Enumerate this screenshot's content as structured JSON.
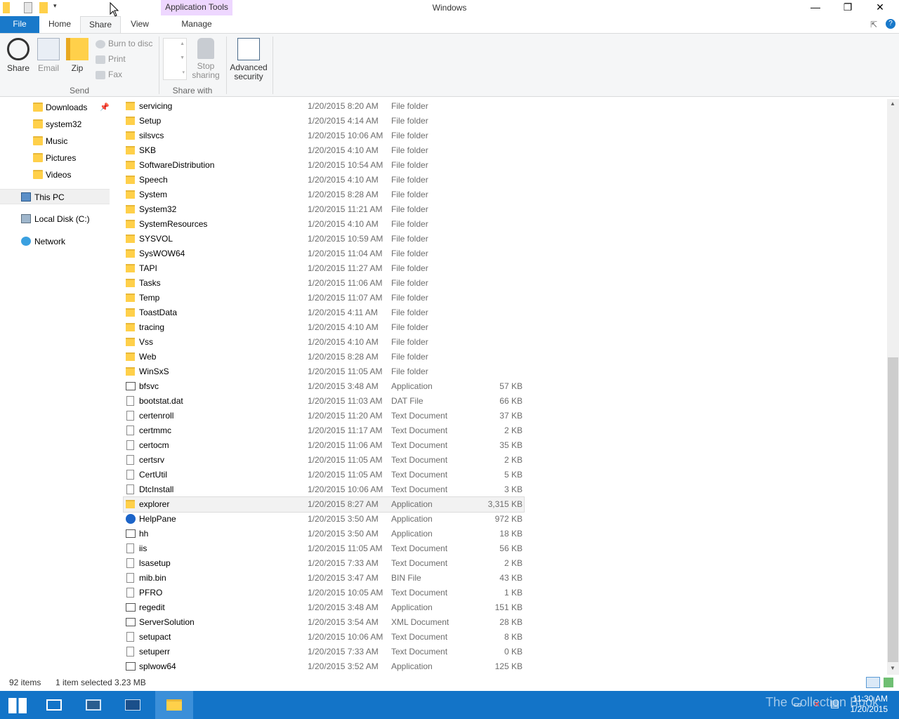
{
  "window": {
    "title": "Windows",
    "context_tab": "Application Tools",
    "controls": {
      "minimize": "—",
      "restore": "❐",
      "close": "✕"
    }
  },
  "ribbon_tabs": [
    "File",
    "Home",
    "Share",
    "View",
    "Manage"
  ],
  "ribbon": {
    "send": {
      "share": "Share",
      "email": "Email",
      "zip": "Zip",
      "burn": "Burn to disc",
      "print": "Print",
      "fax": "Fax",
      "group_label": "Send"
    },
    "share_with": {
      "stop_sharing_1": "Stop",
      "stop_sharing_2": "sharing",
      "group_label": "Share with"
    },
    "advanced_security_1": "Advanced",
    "advanced_security_2": "security"
  },
  "nav": {
    "items": [
      {
        "label": "Downloads"
      },
      {
        "label": "system32"
      },
      {
        "label": "Music"
      },
      {
        "label": "Pictures"
      },
      {
        "label": "Videos"
      },
      {
        "label": "This PC"
      },
      {
        "label": "Local Disk (C:)"
      },
      {
        "label": "Network"
      }
    ]
  },
  "files": [
    {
      "name": "servicing",
      "date": "1/20/2015 8:20 AM",
      "type": "File folder",
      "size": "",
      "icon": "folder"
    },
    {
      "name": "Setup",
      "date": "1/20/2015 4:14 AM",
      "type": "File folder",
      "size": "",
      "icon": "folder"
    },
    {
      "name": "silsvcs",
      "date": "1/20/2015 10:06 AM",
      "type": "File folder",
      "size": "",
      "icon": "folder"
    },
    {
      "name": "SKB",
      "date": "1/20/2015 4:10 AM",
      "type": "File folder",
      "size": "",
      "icon": "folder"
    },
    {
      "name": "SoftwareDistribution",
      "date": "1/20/2015 10:54 AM",
      "type": "File folder",
      "size": "",
      "icon": "folder"
    },
    {
      "name": "Speech",
      "date": "1/20/2015 4:10 AM",
      "type": "File folder",
      "size": "",
      "icon": "folder"
    },
    {
      "name": "System",
      "date": "1/20/2015 8:28 AM",
      "type": "File folder",
      "size": "",
      "icon": "folder"
    },
    {
      "name": "System32",
      "date": "1/20/2015 11:21 AM",
      "type": "File folder",
      "size": "",
      "icon": "folder"
    },
    {
      "name": "SystemResources",
      "date": "1/20/2015 4:10 AM",
      "type": "File folder",
      "size": "",
      "icon": "folder"
    },
    {
      "name": "SYSVOL",
      "date": "1/20/2015 10:59 AM",
      "type": "File folder",
      "size": "",
      "icon": "folder"
    },
    {
      "name": "SysWOW64",
      "date": "1/20/2015 11:04 AM",
      "type": "File folder",
      "size": "",
      "icon": "folder"
    },
    {
      "name": "TAPI",
      "date": "1/20/2015 11:27 AM",
      "type": "File folder",
      "size": "",
      "icon": "folder"
    },
    {
      "name": "Tasks",
      "date": "1/20/2015 11:06 AM",
      "type": "File folder",
      "size": "",
      "icon": "folder"
    },
    {
      "name": "Temp",
      "date": "1/20/2015 11:07 AM",
      "type": "File folder",
      "size": "",
      "icon": "folder"
    },
    {
      "name": "ToastData",
      "date": "1/20/2015 4:11 AM",
      "type": "File folder",
      "size": "",
      "icon": "folder"
    },
    {
      "name": "tracing",
      "date": "1/20/2015 4:10 AM",
      "type": "File folder",
      "size": "",
      "icon": "folder"
    },
    {
      "name": "Vss",
      "date": "1/20/2015 4:10 AM",
      "type": "File folder",
      "size": "",
      "icon": "folder"
    },
    {
      "name": "Web",
      "date": "1/20/2015 8:28 AM",
      "type": "File folder",
      "size": "",
      "icon": "folder"
    },
    {
      "name": "WinSxS",
      "date": "1/20/2015 11:05 AM",
      "type": "File folder",
      "size": "",
      "icon": "folder"
    },
    {
      "name": "bfsvc",
      "date": "1/20/2015 3:48 AM",
      "type": "Application",
      "size": "57 KB",
      "icon": "app"
    },
    {
      "name": "bootstat.dat",
      "date": "1/20/2015 11:03 AM",
      "type": "DAT File",
      "size": "66 KB",
      "icon": "doc"
    },
    {
      "name": "certenroll",
      "date": "1/20/2015 11:20 AM",
      "type": "Text Document",
      "size": "37 KB",
      "icon": "doc"
    },
    {
      "name": "certmmc",
      "date": "1/20/2015 11:17 AM",
      "type": "Text Document",
      "size": "2 KB",
      "icon": "doc"
    },
    {
      "name": "certocm",
      "date": "1/20/2015 11:06 AM",
      "type": "Text Document",
      "size": "35 KB",
      "icon": "doc"
    },
    {
      "name": "certsrv",
      "date": "1/20/2015 11:05 AM",
      "type": "Text Document",
      "size": "2 KB",
      "icon": "doc"
    },
    {
      "name": "CertUtil",
      "date": "1/20/2015 11:05 AM",
      "type": "Text Document",
      "size": "5 KB",
      "icon": "doc"
    },
    {
      "name": "DtcInstall",
      "date": "1/20/2015 10:06 AM",
      "type": "Text Document",
      "size": "3 KB",
      "icon": "doc"
    },
    {
      "name": "explorer",
      "date": "1/20/2015 8:27 AM",
      "type": "Application",
      "size": "3,315 KB",
      "icon": "folder",
      "selected": true
    },
    {
      "name": "HelpPane",
      "date": "1/20/2015 3:50 AM",
      "type": "Application",
      "size": "972 KB",
      "icon": "help"
    },
    {
      "name": "hh",
      "date": "1/20/2015 3:50 AM",
      "type": "Application",
      "size": "18 KB",
      "icon": "app"
    },
    {
      "name": "iis",
      "date": "1/20/2015 11:05 AM",
      "type": "Text Document",
      "size": "56 KB",
      "icon": "doc"
    },
    {
      "name": "lsasetup",
      "date": "1/20/2015 7:33 AM",
      "type": "Text Document",
      "size": "2 KB",
      "icon": "doc"
    },
    {
      "name": "mib.bin",
      "date": "1/20/2015 3:47 AM",
      "type": "BIN File",
      "size": "43 KB",
      "icon": "doc"
    },
    {
      "name": "PFRO",
      "date": "1/20/2015 10:05 AM",
      "type": "Text Document",
      "size": "1 KB",
      "icon": "doc"
    },
    {
      "name": "regedit",
      "date": "1/20/2015 3:48 AM",
      "type": "Application",
      "size": "151 KB",
      "icon": "app"
    },
    {
      "name": "ServerSolution",
      "date": "1/20/2015 3:54 AM",
      "type": "XML Document",
      "size": "28 KB",
      "icon": "app"
    },
    {
      "name": "setupact",
      "date": "1/20/2015 10:06 AM",
      "type": "Text Document",
      "size": "8 KB",
      "icon": "doc"
    },
    {
      "name": "setuperr",
      "date": "1/20/2015 7:33 AM",
      "type": "Text Document",
      "size": "0 KB",
      "icon": "doc"
    },
    {
      "name": "splwow64",
      "date": "1/20/2015 3:52 AM",
      "type": "Application",
      "size": "125 KB",
      "icon": "app"
    }
  ],
  "status": {
    "item_count": "92 items",
    "selection": "1 item selected  3.23 MB"
  },
  "taskbar": {
    "watermark": "The Collection Book",
    "time": "11:30 AM",
    "date": "1/20/2015"
  },
  "colors": {
    "accent": "#1979ca",
    "taskbar": "#1374c8",
    "context_tab": "#eed7ff",
    "folder": "#ffd04a"
  }
}
